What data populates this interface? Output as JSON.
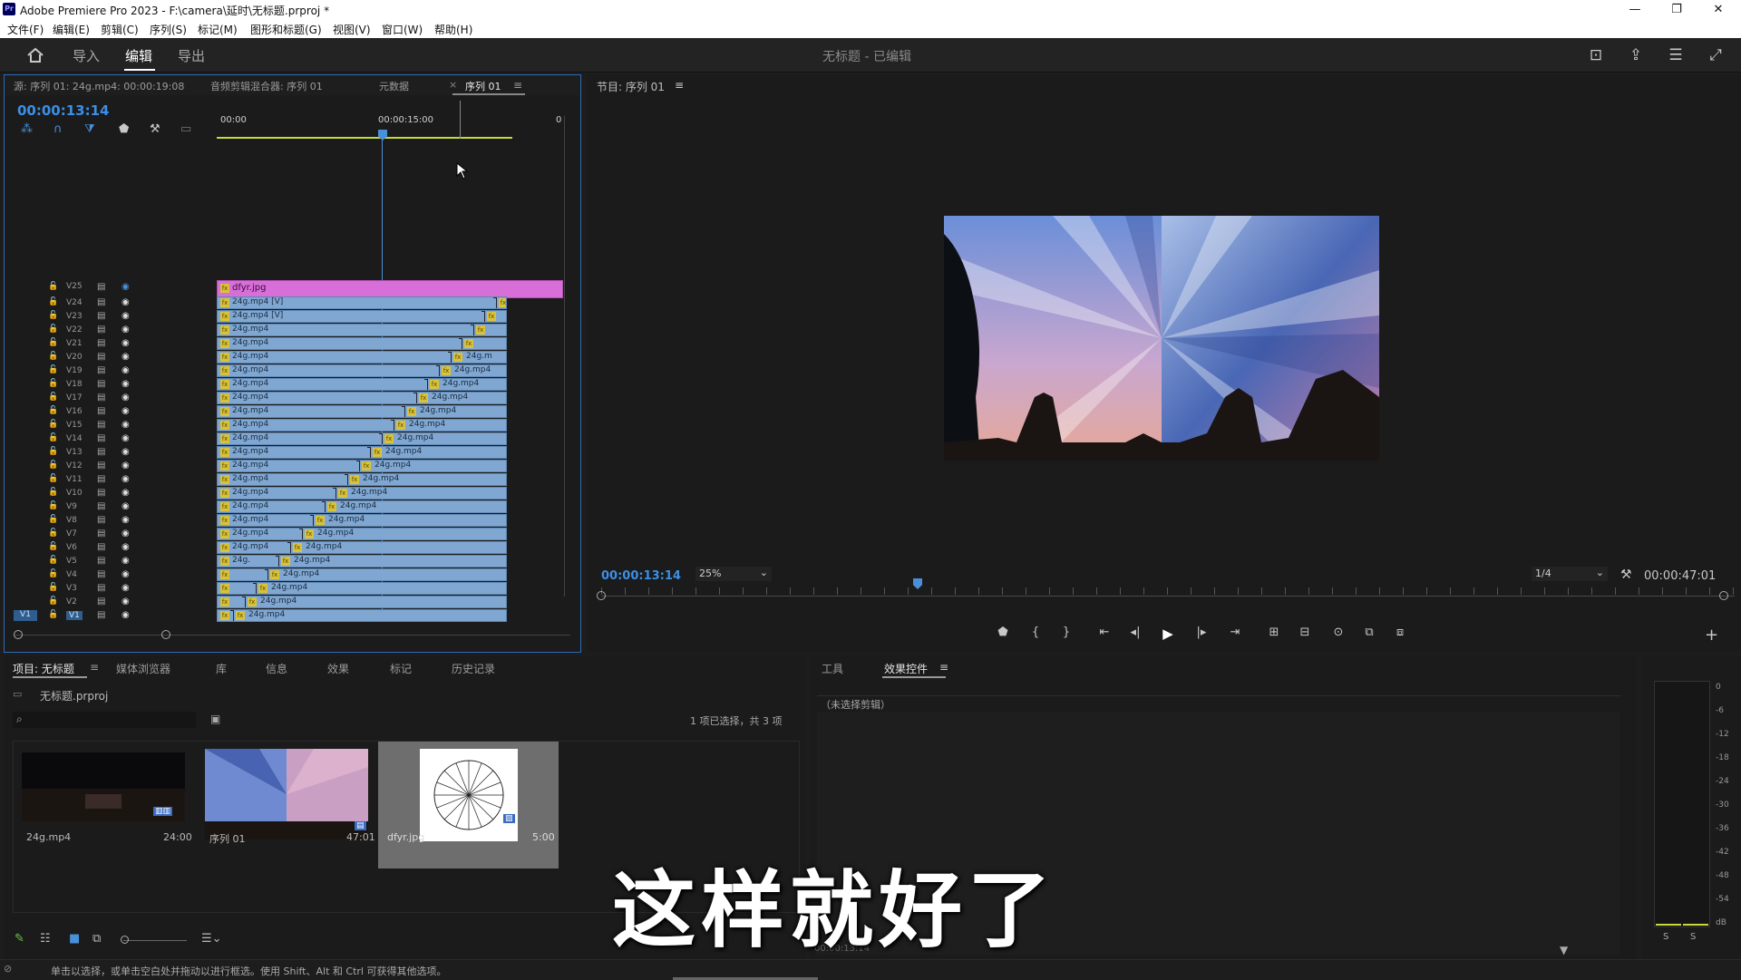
{
  "window": {
    "title": "Adobe Premiere Pro 2023 - F:\\camera\\延时\\无标题.prproj *",
    "app_badge": "Pr",
    "min": "—",
    "max": "❐",
    "close": "✕"
  },
  "menu": [
    "文件(F)",
    "编辑(E)",
    "剪辑(C)",
    "序列(S)",
    "标记(M)",
    "图形和标题(G)",
    "视图(V)",
    "窗口(W)",
    "帮助(H)"
  ],
  "nav": {
    "home_icon": "home-icon",
    "tabs": [
      "导入",
      "编辑",
      "导出"
    ],
    "active": "编辑",
    "project_title": "无标题 - 已编辑"
  },
  "source_panel": {
    "tabs": [
      "源: 序列 01: 24g.mp4: 00:00:19:08",
      "音频剪辑混合器: 序列 01",
      "元数据",
      "序列 01"
    ],
    "close_glyph": "×",
    "menu_glyph": "≡"
  },
  "timeline": {
    "timecode": "00:00:13:14",
    "ruler": [
      "00:00",
      "00:00:15:00",
      "0"
    ],
    "tool_icons": [
      "snap-icon",
      "linked-selection-icon",
      "marker-add-icon",
      "marker-icon",
      "wrench-icon",
      "caption-icon"
    ],
    "v25_clip": "dfyr.jpg",
    "tracks": [
      "V25",
      "V24",
      "V23",
      "V22",
      "V21",
      "V20",
      "V19",
      "V18",
      "V17",
      "V16",
      "V15",
      "V14",
      "V13",
      "V12",
      "V11",
      "V10",
      "V9",
      "V8",
      "V7",
      "V6",
      "V5",
      "V4",
      "V3",
      "V2",
      "V1"
    ],
    "v1_source": "V1",
    "clip_left_labels": [
      "24g.mp4 [V]",
      "24g.mp4 [V]",
      "24g.mp4",
      "24g.mp4",
      "24g.mp4",
      "24g.mp4",
      "24g.mp4",
      "24g.mp4",
      "24g.mp4",
      "24g.mp4",
      "24g.mp4",
      "24g.mp4",
      "24g.mp4",
      "24g.mp4",
      "24g.mp4",
      "24g.mp4",
      "24g.mp4",
      "24g.mp4",
      "24g.mp4",
      "24g.",
      "",
      "",
      "",
      ""
    ],
    "clip_right_labels": [
      "",
      "",
      "",
      "",
      "24g.m",
      "24g.mp4",
      "24g.mp4",
      "24g.mp4",
      "24g.mp4",
      "24g.mp4",
      "24g.mp4",
      "24g.mp4",
      "24g.mp4",
      "24g.mp4",
      "24g.mp4",
      "24g.mp4",
      "24g.mp4",
      "24g.mp4",
      "24g.mp4",
      "24g.mp4",
      "24g.mp4",
      "24g.mp4",
      "24g.mp4",
      "24g.mp4"
    ]
  },
  "program": {
    "tab": "节目: 序列 01",
    "menu_glyph": "≡",
    "timecode": "00:00:13:14",
    "zoom": "25%",
    "resolution": "1/4",
    "duration": "00:00:47:01",
    "controls": [
      "marker-icon",
      "in-point-icon",
      "out-point-icon",
      "go-to-in-icon",
      "step-back-icon",
      "play-icon",
      "step-forward-icon",
      "go-to-out-icon",
      "insert-icon",
      "overwrite-icon",
      "export-frame-icon",
      "comparison-view-icon",
      "vr-icon"
    ],
    "control_glyphs": [
      "⬟",
      "{",
      "}",
      "⇤",
      "◂|",
      "▶",
      "|▸",
      "⇥",
      "⊞",
      "⊟",
      "⊙",
      "⧉",
      "⧈"
    ],
    "add_glyph": "+"
  },
  "project": {
    "tabs": [
      "项目: 无标题",
      "媒体浏览器",
      "库",
      "信息",
      "效果",
      "标记",
      "历史记录"
    ],
    "menu_glyph": "≡",
    "file": "无标题.prproj",
    "search_placeholder": "",
    "selection": "1 项已选择，共 3 项",
    "items": [
      {
        "name": "24g.mp4",
        "duration": "24:00"
      },
      {
        "name": "序列 01",
        "duration": "47:01"
      },
      {
        "name": "dfyr.jpg",
        "duration": "5:00"
      }
    ]
  },
  "effects": {
    "tabs": [
      "工具",
      "效果控件"
    ],
    "menu_glyph": "≡",
    "no_clip": "（未选择剪辑）",
    "timecode": "00:00:13:14"
  },
  "meter": {
    "scale": [
      "0",
      "-6",
      "-12",
      "-18",
      "-24",
      "-30",
      "-36",
      "-42",
      "-48",
      "-54",
      "dB"
    ],
    "solo": [
      "S",
      "S"
    ]
  },
  "status": "单击以选择，或单击空白处并拖动以进行框选。使用 Shift、Alt 和 Ctrl 可获得其他选项。",
  "subtitle": "这样就好了"
}
